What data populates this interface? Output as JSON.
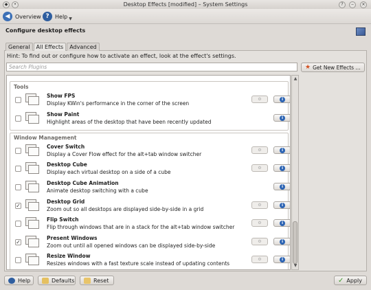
{
  "window": {
    "title": "Desktop Effects [modified] – System Settings"
  },
  "toolbar": {
    "overview_label": "Overview",
    "help_label": "Help"
  },
  "header": {
    "title": "Configure desktop effects"
  },
  "tabs": [
    {
      "label": "General",
      "active": false
    },
    {
      "label": "All Effects",
      "active": true
    },
    {
      "label": "Advanced",
      "active": false
    }
  ],
  "hint": "Hint: To find out or configure how to activate an effect, look at the effect's settings.",
  "search": {
    "placeholder": "Search Plugins",
    "value": ""
  },
  "get_new_button": "Get New Effects ...",
  "groups": [
    {
      "label": "Tools",
      "effects": [
        {
          "name": "Show FPS",
          "description": "Display KWin's performance in the corner of the screen",
          "checked": false
        },
        {
          "name": "Show Paint",
          "description": "Highlight areas of the desktop that have been recently updated",
          "checked": false
        }
      ]
    },
    {
      "label": "Window Management",
      "effects": [
        {
          "name": "Cover Switch",
          "description": "Display a Cover Flow effect for the alt+tab window switcher",
          "checked": false
        },
        {
          "name": "Desktop Cube",
          "description": "Display each virtual desktop on a side of a cube",
          "checked": false
        },
        {
          "name": "Desktop Cube Animation",
          "description": "Animate desktop switching with a cube",
          "checked": false
        },
        {
          "name": "Desktop Grid",
          "description": "Zoom out so all desktops are displayed side-by-side in a grid",
          "checked": true
        },
        {
          "name": "Flip Switch",
          "description": "Flip through windows that are in a stack for the alt+tab window switcher",
          "checked": false
        },
        {
          "name": "Present Windows",
          "description": "Zoom out until all opened windows can be displayed side-by-side",
          "checked": true
        },
        {
          "name": "Resize Window",
          "description": "Resizes windows with a fast texture scale instead of updating contents",
          "checked": false
        }
      ]
    }
  ],
  "bottom": {
    "help": "Help",
    "defaults": "Defaults",
    "reset": "Reset",
    "apply": "Apply"
  },
  "colors": {
    "accent": "#2b63b3",
    "window_bg": "#dedad6",
    "list_bg": "#ffffff"
  }
}
